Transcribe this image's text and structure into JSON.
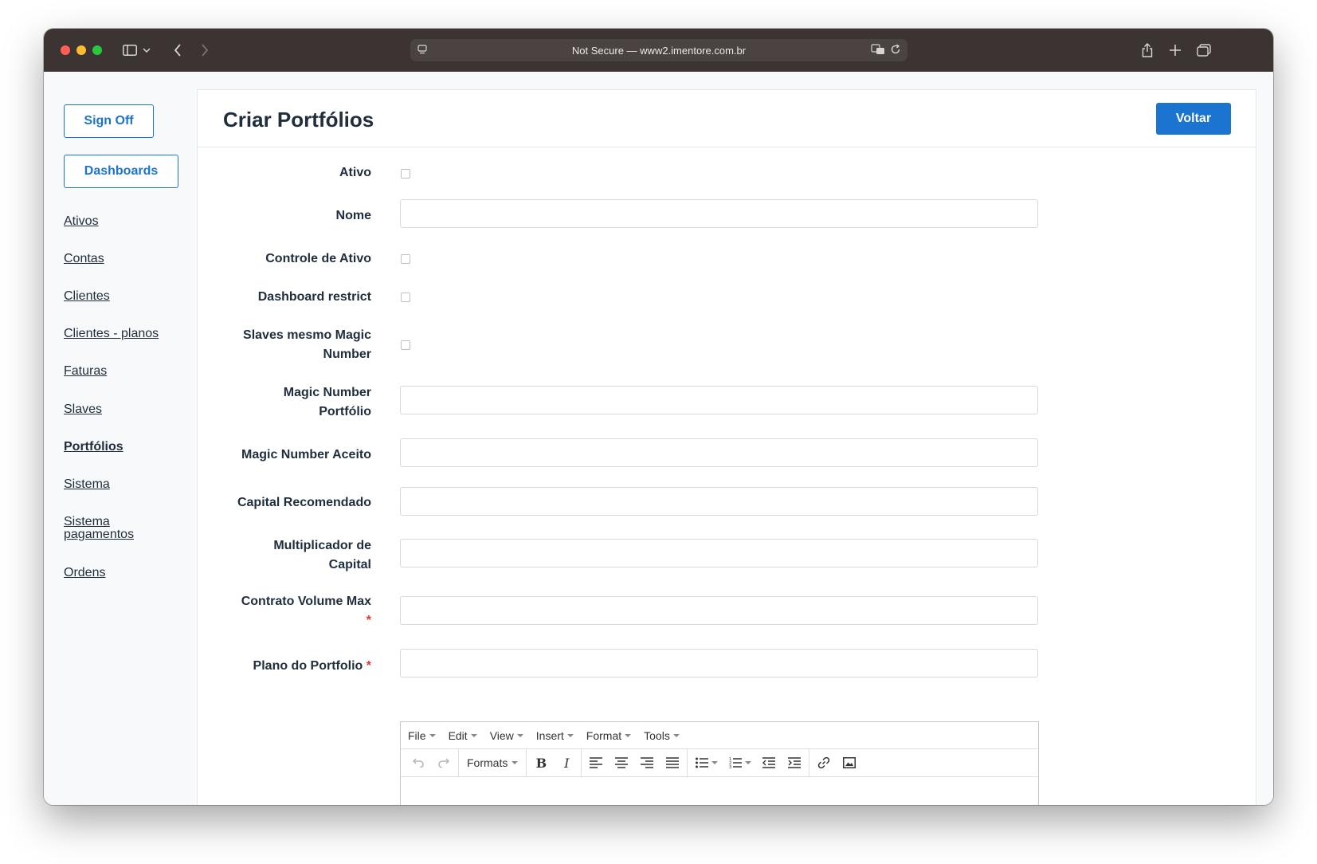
{
  "browser": {
    "url_text": "Not Secure — www2.imentore.com.br"
  },
  "sidebar": {
    "sign_off": "Sign Off",
    "dashboards": "Dashboards",
    "links": [
      "Ativos",
      "Contas",
      "Clientes",
      "Clientes - planos",
      "Faturas",
      "Slaves",
      "Portfólios",
      "Sistema",
      "Sistema pagamentos",
      "Ordens"
    ],
    "active": "Portfólios"
  },
  "main": {
    "title": "Criar Portfólios",
    "back_button": "Voltar"
  },
  "form": {
    "ativo": "Ativo",
    "nome": "Nome",
    "controle_ativo": "Controle de Ativo",
    "dashboard_restrict": "Dashboard restrict",
    "slaves_magic": "Slaves mesmo Magic Number",
    "magic_portfolio": "Magic Number Portfólio",
    "magic_aceito": "Magic Number Aceito",
    "capital_recomendado": "Capital Recomendado",
    "multiplicador": "Multiplicador de Capital",
    "contrato_volume": "Contrato Volume Max",
    "plano_portfolio": "Plano do Portfolio",
    "required_mark": "*"
  },
  "editor": {
    "menus": [
      "File",
      "Edit",
      "View",
      "Insert",
      "Format",
      "Tools"
    ],
    "formats_label": "Formats"
  },
  "colors": {
    "primary": "#1b75d0",
    "text": "#1f2d3d",
    "required": "#e3342f"
  }
}
